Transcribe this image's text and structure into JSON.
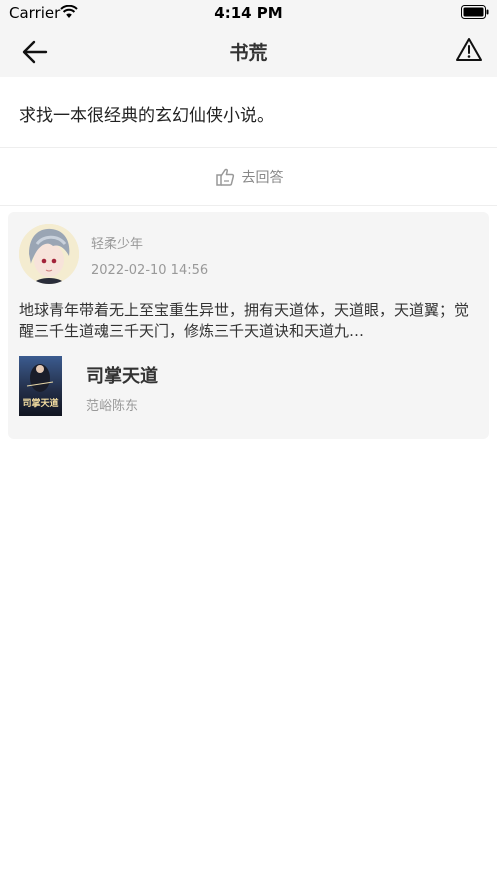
{
  "status_bar": {
    "carrier": "Carrier",
    "time": "4:14 PM"
  },
  "nav": {
    "title": "书荒",
    "back_icon": "arrow-left-icon",
    "report_icon": "warning-triangle-icon"
  },
  "question": {
    "text": "求找一本很经典的玄幻仙侠小说。"
  },
  "answer_button": {
    "label": "去回答",
    "icon": "edit-hand-icon"
  },
  "answer_card": {
    "username": "轻柔少年",
    "timestamp": "2022-02-10 14:56",
    "text": "地球青年带着无上至宝重生异世，拥有天道体，天道眼，天道翼；觉醒三千生道魂三千天门，修炼三千天道诀和天道九…",
    "book": {
      "title": "司掌天道",
      "author": "范峪陈东",
      "cover_text": "司掌天道"
    }
  },
  "colors": {
    "bar_bg": "#f5f5f5",
    "card_bg": "#f5f5f5",
    "muted_text": "#999999",
    "primary_text": "#333333"
  }
}
